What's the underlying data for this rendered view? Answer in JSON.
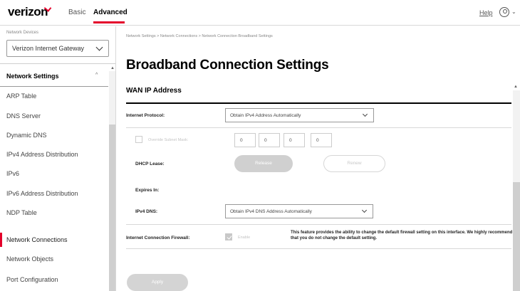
{
  "header": {
    "logo": "verizon",
    "nav": {
      "basic": "Basic",
      "advanced": "Advanced"
    },
    "help": "Help",
    "user_caret": "⌄",
    "accent_color": "#e4002b"
  },
  "sidebar": {
    "devices_label": "Network Devices",
    "device_select_value": "Verizon Internet Gateway",
    "section_header": "Network Settings",
    "section_caret": "^",
    "scroll_up_glyph": "▲",
    "items": [
      {
        "label": "ARP Table"
      },
      {
        "label": "DNS Server"
      },
      {
        "label": "Dynamic DNS"
      },
      {
        "label": "IPv4 Address Distribution"
      },
      {
        "label": "IPv6"
      },
      {
        "label": "IPv6 Address Distribution"
      },
      {
        "label": "NDP Table"
      },
      {
        "label": "Network Connections",
        "active": true
      },
      {
        "label": "Network Objects"
      },
      {
        "label": "Port Configuration"
      }
    ]
  },
  "main": {
    "breadcrumb": "Network Settings  >  Network Connections  >  Network Connection Broadband Settings",
    "title": "Broadband Connection Settings",
    "section_title": "WAN IP Address",
    "scroll_up_glyph": "▲",
    "internet_protocol": {
      "label": "Internet Protocol:",
      "value": "Obtain IPv4 Address Automatically"
    },
    "subnet": {
      "override_label": "Override Subnet Mask:",
      "octets": [
        "0",
        "0",
        "0",
        "0"
      ]
    },
    "dhcp_lease": {
      "label": "DHCP Lease:",
      "release": "Release",
      "renew": "Renew"
    },
    "expires_in": {
      "label": "Expires In:"
    },
    "ipv4_dns": {
      "label": "IPv4 DNS:",
      "value": "Obtain IPv4 DNS Address Automatically"
    },
    "firewall": {
      "label": "Internet Connection Firewall:",
      "enable_label": "Enable",
      "description": "This feature provides the ability to change the default firewall setting on this interface. We highly recommend that you do not change the default setting."
    },
    "apply": "Apply"
  }
}
